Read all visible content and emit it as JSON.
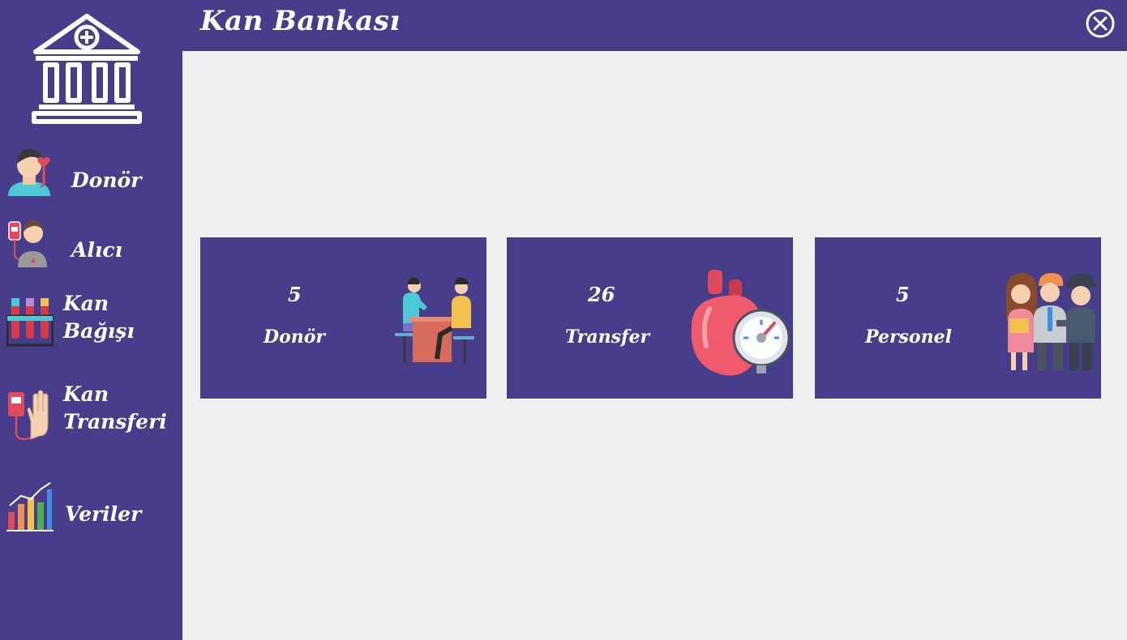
{
  "app": {
    "title": "Kan Bankası"
  },
  "icons": {
    "close": "close-circle-icon",
    "logo": "bank-building-icon"
  },
  "sidebar": {
    "items": [
      {
        "label_line1": "Donör",
        "label_line2": "",
        "icon": "donor-icon"
      },
      {
        "label_line1": "Alıcı",
        "label_line2": "",
        "icon": "recipient-icon"
      },
      {
        "label_line1": "Kan",
        "label_line2": "Bağışı",
        "icon": "test-tubes-icon"
      },
      {
        "label_line1": "Kan",
        "label_line2": "Transferi",
        "icon": "blood-transfer-icon"
      },
      {
        "label_line1": "Veriler",
        "label_line2": "",
        "icon": "chart-icon"
      }
    ]
  },
  "cards": [
    {
      "value": "5",
      "label": "Donör",
      "illustration": "donation-meeting-illustration"
    },
    {
      "value": "26",
      "label": "Transfer",
      "illustration": "heart-gauge-illustration"
    },
    {
      "value": "5",
      "label": "Personel",
      "illustration": "staff-group-illustration"
    }
  ],
  "colors": {
    "primary": "#483d8b",
    "background": "#f0f0f0",
    "text": "#ffffff"
  }
}
